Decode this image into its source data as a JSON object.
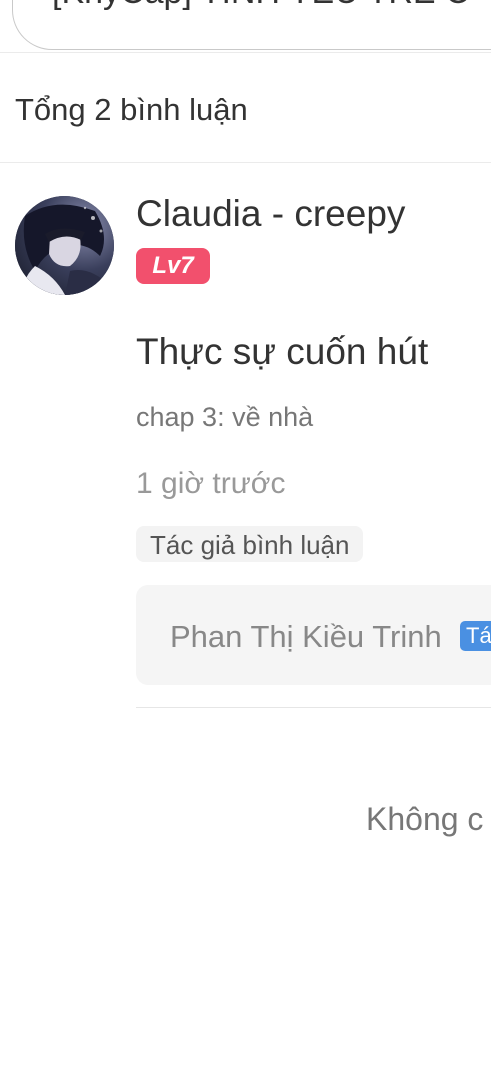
{
  "header": {
    "title_fragment": "[KhyCap] TÌNH YÊU TRE C"
  },
  "comments_section": {
    "total_label": "Tổng 2 bình luận"
  },
  "comment": {
    "username": "Claudia - creepy",
    "level": "Lv7",
    "text": "Thực sự cuốn hút",
    "chapter": "chap 3: về nhà",
    "time": "1 giờ trước",
    "author_reply_label": "Tác giả bình luận",
    "reply": {
      "name": "Phan Thị Kiều Trinh",
      "tag": "Tá"
    }
  },
  "footer": {
    "end_note": "Không c"
  },
  "colors": {
    "level_badge": "#f2506d",
    "author_tag_blue": "#4a90e2"
  }
}
